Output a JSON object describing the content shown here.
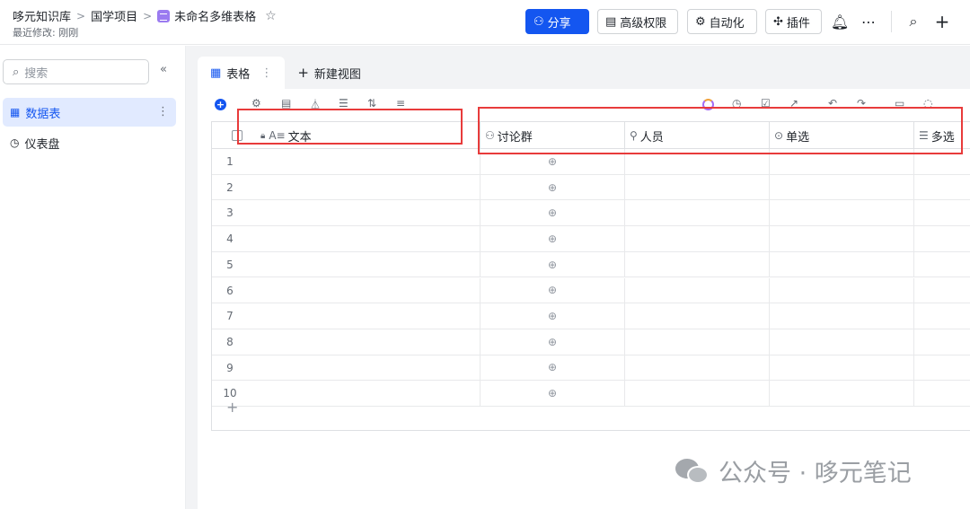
{
  "header": {
    "breadcrumbs": [
      "哆元知识库",
      "国学项目",
      "未命名多维表格"
    ],
    "last_modified": "最近修改: 刚刚",
    "buttons": {
      "share": "分享",
      "permissions": "高级权限",
      "automation": "自动化",
      "plugins": "插件"
    }
  },
  "sidebar": {
    "search_placeholder": "搜索",
    "items": [
      {
        "label": "数据表",
        "icon": "table-icon",
        "active": true
      },
      {
        "label": "仪表盘",
        "icon": "dashboard-icon",
        "active": false
      }
    ]
  },
  "views": {
    "tabs": [
      {
        "label": "表格",
        "active": true
      },
      {
        "label": "新建视图",
        "active": false
      }
    ]
  },
  "grid": {
    "columns": [
      {
        "label": "文本",
        "icon": "text-field-icon",
        "locked": true
      },
      {
        "label": "讨论群",
        "icon": "group-field-icon"
      },
      {
        "label": "人员",
        "icon": "person-field-icon"
      },
      {
        "label": "单选",
        "icon": "single-select-icon"
      },
      {
        "label": "多选",
        "icon": "multi-select-icon"
      }
    ],
    "row_numbers": [
      "1",
      "2",
      "3",
      "4",
      "5",
      "6",
      "7",
      "8",
      "9",
      "10"
    ]
  },
  "watermark": "公众号 · 哆元笔记",
  "colors": {
    "accent": "#1456f0",
    "highlight_box": "#e83b3b"
  }
}
